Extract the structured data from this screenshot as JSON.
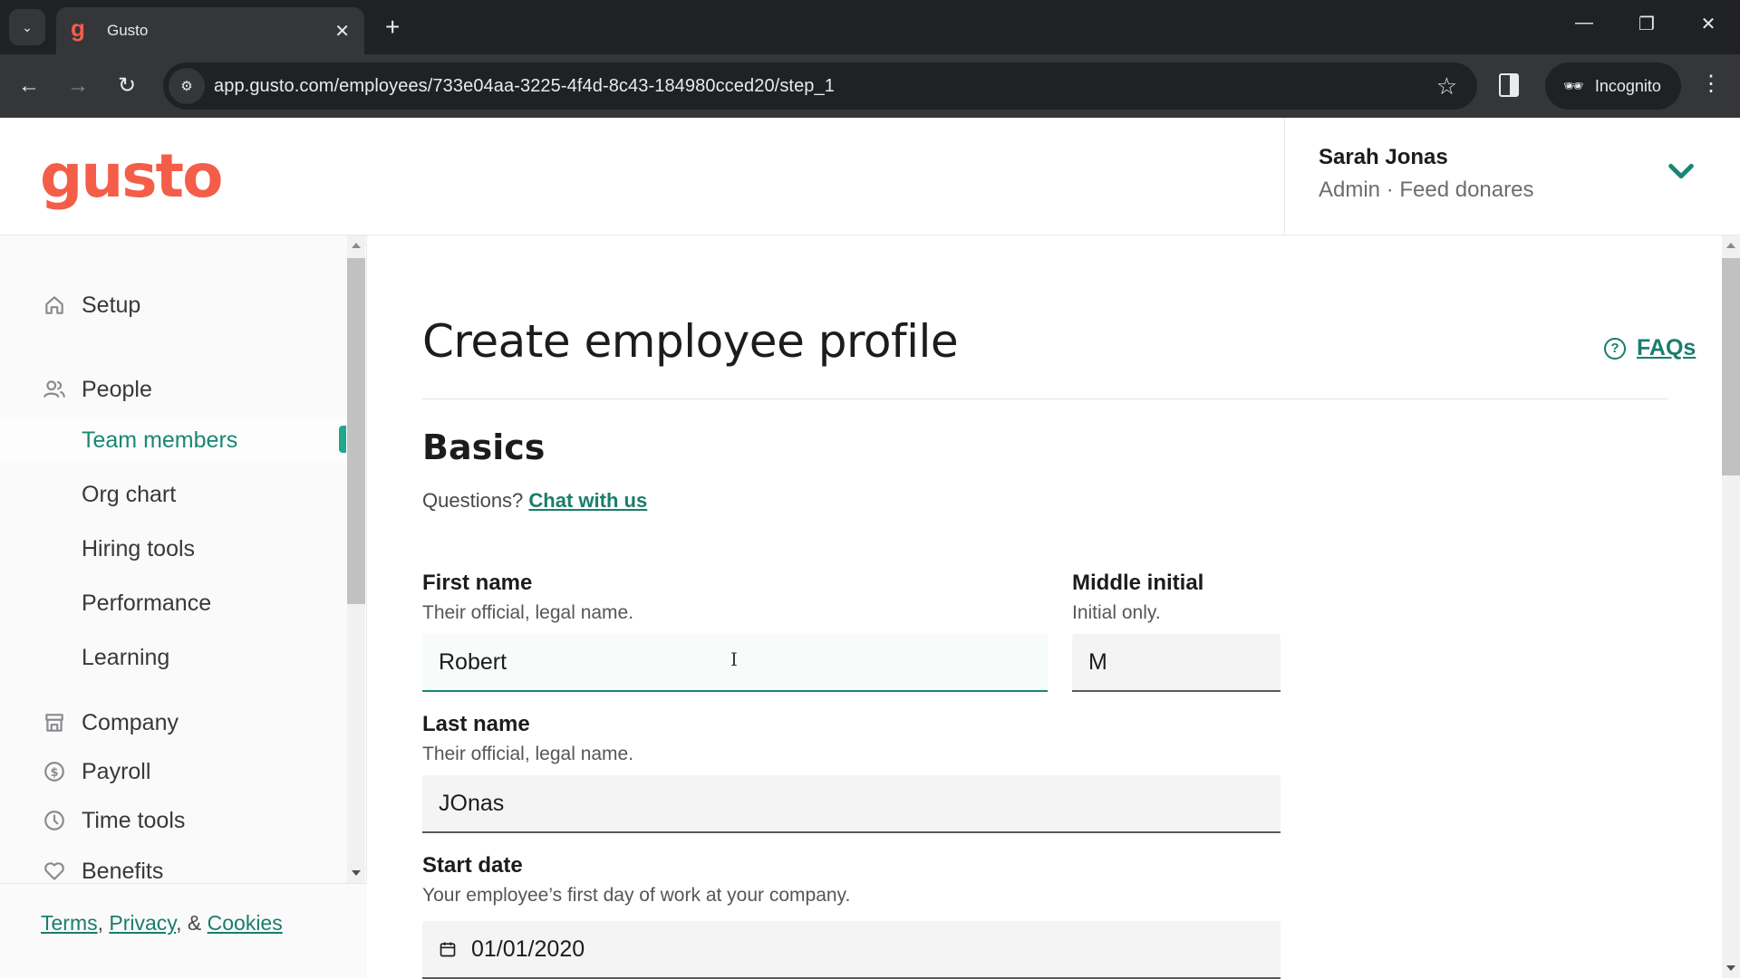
{
  "browser": {
    "tab_title": "Gusto",
    "tab_favicon": "g",
    "url": "app.gusto.com/employees/733e04aa-3225-4f4d-8c43-184980cced20/step_1",
    "incognito_label": "Incognito"
  },
  "header": {
    "logo": "gusto",
    "user_name": "Sarah Jonas",
    "user_role": "Admin · Feed donares"
  },
  "sidebar": {
    "items": [
      {
        "label": "Setup",
        "icon": "home-icon"
      },
      {
        "label": "People",
        "icon": "people-icon"
      },
      {
        "label": "Team members",
        "active": true
      },
      {
        "label": "Org chart"
      },
      {
        "label": "Hiring tools"
      },
      {
        "label": "Performance"
      },
      {
        "label": "Learning"
      },
      {
        "label": "Company",
        "icon": "store-icon"
      },
      {
        "label": "Payroll",
        "icon": "dollar-icon"
      },
      {
        "label": "Time tools",
        "icon": "clock-icon"
      },
      {
        "label": "Benefits",
        "icon": "heart-icon"
      }
    ],
    "footer": {
      "terms": "Terms",
      "privacy": "Privacy",
      "amp": ", &",
      "cookies": "Cookies",
      "sep": ","
    }
  },
  "main": {
    "title": "Create employee profile",
    "faqs_label": "FAQs",
    "section_title": "Basics",
    "questions_text": "Questions?",
    "chat_link": "Chat with us",
    "fields": {
      "first_name": {
        "label": "First name",
        "hint": "Their official, legal name.",
        "value": "Robert"
      },
      "middle_initial": {
        "label": "Middle initial",
        "hint": "Initial only.",
        "value": "M"
      },
      "last_name": {
        "label": "Last name",
        "hint": "Their official, legal name.",
        "value": "JOnas"
      },
      "start_date": {
        "label": "Start date",
        "hint": "Your employee’s first day of work at your company.",
        "value": "01/01/2020"
      }
    }
  },
  "colors": {
    "brand": "#f45d48",
    "accent": "#1a8674"
  }
}
